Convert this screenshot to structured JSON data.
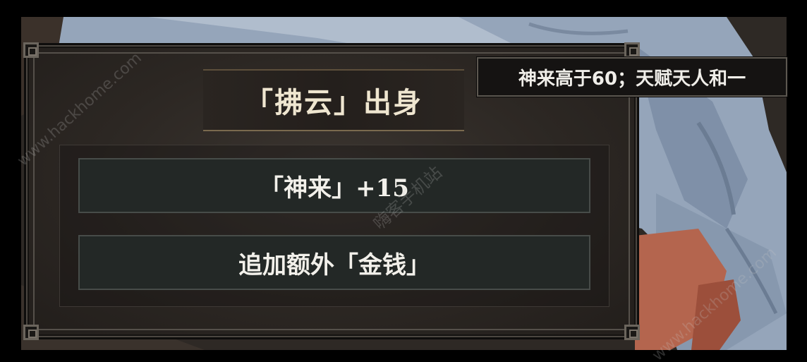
{
  "panel": {
    "title": "「拂云」出身",
    "options": [
      {
        "label": "「神来」+15"
      },
      {
        "label": "追加额外「金钱」"
      }
    ]
  },
  "tooltip": {
    "text": "神来高于60；天赋天人和一"
  },
  "watermarks": {
    "left": "www.hackhome.com",
    "center": "嗨客手机站",
    "right": "www.hackhome.com"
  },
  "colors": {
    "panel_bg": "#2c2723",
    "title_text": "#efe6d0",
    "option_bg": "#232826",
    "tooltip_bg": "#151312",
    "robe_blue": "#9aa9bd",
    "cloth_red": "#b96a52"
  }
}
